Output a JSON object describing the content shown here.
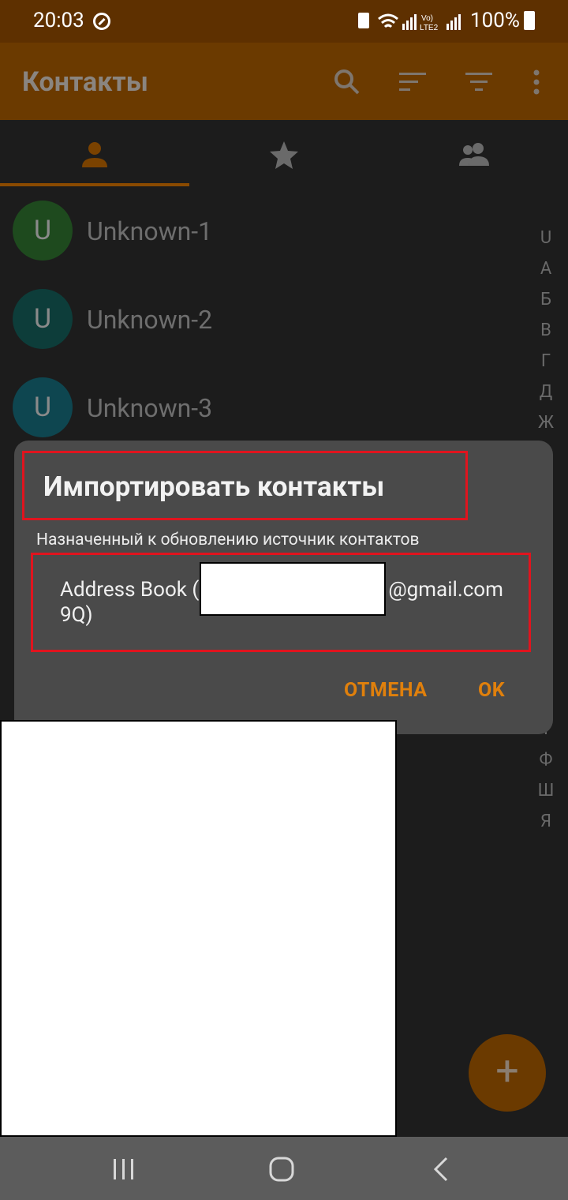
{
  "status_bar": {
    "time": "20:03",
    "battery": "100%",
    "icons": [
      "vpn-shield-icon",
      "battery-saver-icon",
      "wifi-icon",
      "signal-icon",
      "volte-icon",
      "signal-2-icon",
      "battery-icon"
    ]
  },
  "toolbar": {
    "title": "Контакты",
    "icons": [
      "search-icon",
      "sort-icon",
      "filter-icon",
      "more-vert-icon"
    ]
  },
  "tabs": [
    {
      "icon": "person-icon",
      "selected": true
    },
    {
      "icon": "star-icon",
      "selected": false
    },
    {
      "icon": "group-icon",
      "selected": false
    }
  ],
  "contacts": [
    {
      "initial": "U",
      "name": "Unknown-1",
      "color": "#1e4a1e"
    },
    {
      "initial": "U",
      "name": "Unknown-2",
      "color": "#0d3d3a"
    },
    {
      "initial": "U",
      "name": "Unknown-3",
      "color": "#0e4650"
    }
  ],
  "alphabet_index_top": [
    "U",
    "А",
    "Б",
    "В",
    "Г",
    "Д",
    "Ж"
  ],
  "alphabet_index_bottom": [
    "Т",
    "Ф",
    "Ш",
    "Я"
  ],
  "dialog": {
    "title": "Импортировать контакты",
    "subtitle": "Назначенный к обновлению источник контактов",
    "source_line1": "Address Book (",
    "source_email_suffix": "@gmail.com",
    "source_line2": "9Q)",
    "cancel_label": "ОТМЕНА",
    "ok_label": "OK"
  },
  "fab": {
    "label": "+"
  },
  "colors": {
    "accent": "#e0800c",
    "toolbar": "#6b3a00",
    "status_bar": "#5e3000",
    "highlight_border": "#e0141e"
  }
}
